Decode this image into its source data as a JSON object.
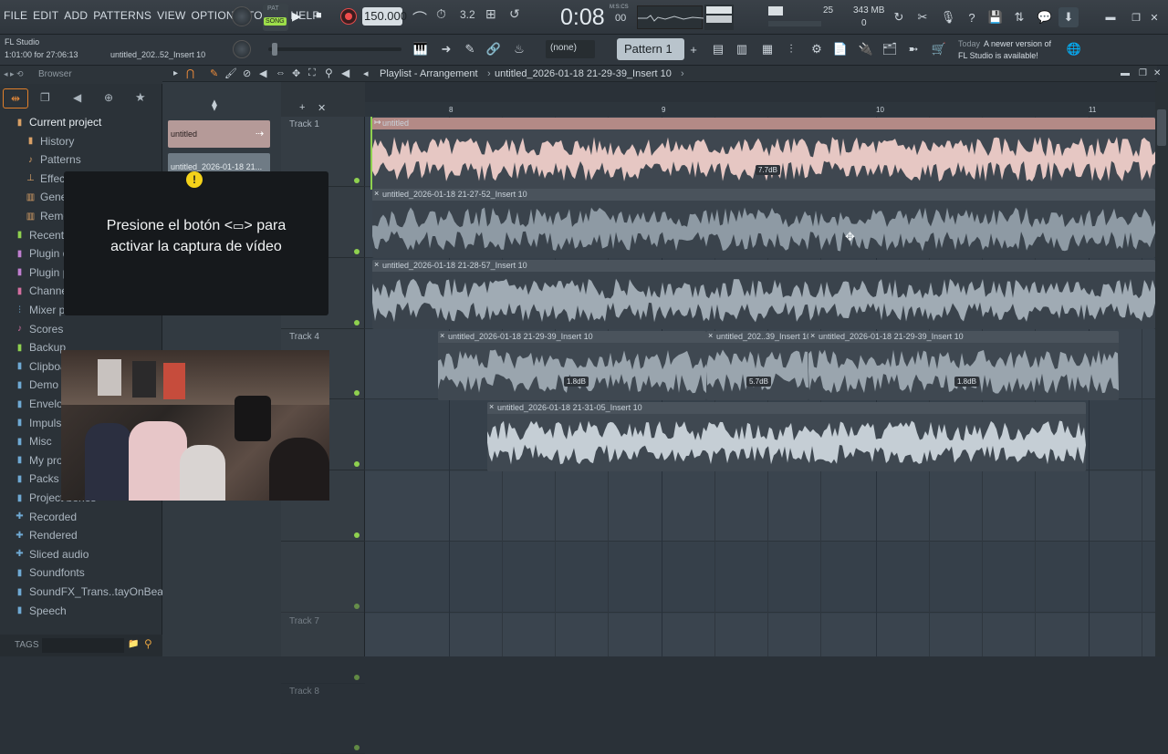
{
  "menu": [
    "FILE",
    "EDIT",
    "ADD",
    "PATTERNS",
    "VIEW",
    "OPTIONS",
    "TOOLS",
    "HELP"
  ],
  "transport": {
    "pat_label": "PAT",
    "song_label": "SONG",
    "tempo": "150.000",
    "time": "0:08",
    "time_small": "00",
    "time_unit": "M:S:CS"
  },
  "cpu": {
    "number": "25",
    "memory": "343 MB",
    "poly": "0"
  },
  "hint": {
    "app": "FL Studio",
    "status": "1:01:00 for 27:06:13",
    "file": "untitled_202..52_Insert 10"
  },
  "pattern": {
    "none": "(none)",
    "name": "Pattern 1"
  },
  "news": {
    "label": "Today",
    "text": "A newer version of",
    "text2": "FL Studio is available!"
  },
  "browser": {
    "title": "Browser",
    "items": [
      {
        "label": "Current project",
        "icon": "folder-icon",
        "color": "#d9a066"
      },
      {
        "label": "History",
        "icon": "history-icon",
        "color": "#d9a066"
      },
      {
        "label": "Patterns",
        "icon": "note-icon",
        "color": "#d9a066"
      },
      {
        "label": "Effects",
        "icon": "plug-icon",
        "color": "#d9a066"
      },
      {
        "label": "Generators",
        "icon": "gen-icon",
        "color": "#d9a066"
      },
      {
        "label": "Remote control",
        "icon": "remote-icon",
        "color": "#d9a066"
      },
      {
        "label": "Recent files",
        "icon": "recent-icon",
        "color": "#8fd14f"
      },
      {
        "label": "Plugin database",
        "icon": "plugin-icon",
        "color": "#c07fd0"
      },
      {
        "label": "Plugin presets",
        "icon": "plugin-icon",
        "color": "#c07fd0"
      },
      {
        "label": "Channel presets",
        "icon": "channel-icon",
        "color": "#d46fa0"
      },
      {
        "label": "Mixer presets",
        "icon": "mixer-icon",
        "color": "#6faad4"
      },
      {
        "label": "Scores",
        "icon": "score-icon",
        "color": "#d46fa0"
      },
      {
        "label": "Backup",
        "icon": "backup-icon",
        "color": "#8fd14f"
      },
      {
        "label": "Clipboard files",
        "icon": "folder-icon",
        "color": "#6faad4"
      },
      {
        "label": "Demo projects",
        "icon": "folder-icon",
        "color": "#6faad4"
      },
      {
        "label": "Envelopes",
        "icon": "folder-icon",
        "color": "#6faad4"
      },
      {
        "label": "Impulses",
        "icon": "folder-icon",
        "color": "#6faad4"
      },
      {
        "label": "Misc",
        "icon": "folder-icon",
        "color": "#6faad4"
      },
      {
        "label": "My projects",
        "icon": "folder-icon",
        "color": "#6faad4"
      },
      {
        "label": "Packs",
        "icon": "folder-icon",
        "color": "#6faad4"
      },
      {
        "label": "Project bones",
        "icon": "folder-icon",
        "color": "#6faad4"
      },
      {
        "label": "Recorded",
        "icon": "plus-icon",
        "color": "#6faad4"
      },
      {
        "label": "Rendered",
        "icon": "plus-icon",
        "color": "#6faad4"
      },
      {
        "label": "Sliced audio",
        "icon": "plus-icon",
        "color": "#6faad4"
      },
      {
        "label": "Soundfonts",
        "icon": "folder-icon",
        "color": "#6faad4"
      },
      {
        "label": "SoundFX_Trans..tayOnBeat_com",
        "icon": "folder-icon",
        "color": "#6faad4"
      },
      {
        "label": "Speech",
        "icon": "folder-icon",
        "color": "#6faad4"
      }
    ],
    "tags": "TAGS"
  },
  "playlist": {
    "title": "Playlist - Arrangement",
    "file": "untitled_2026-01-18 21-29-39_Insert 10",
    "ruler": [
      "8",
      "9",
      "10",
      "11"
    ],
    "tracks": [
      "Track 1",
      "",
      "",
      "Track 4",
      "",
      "",
      "",
      "Track 7",
      "Track 8"
    ]
  },
  "channels": [
    {
      "label": "untitled"
    },
    {
      "label": "untitled_2026-01-18 21..."
    }
  ],
  "clips": [
    {
      "title": "untitled",
      "db": "7.7dB"
    },
    {
      "title": "untitled_2026-01-18 21-27-52_Insert 10"
    },
    {
      "title": "untitled_2026-01-18 21-28-57_Insert 10"
    },
    {
      "title": "untitled_2026-01-18 21-29-39_Insert 10",
      "db": "1.8dB"
    },
    {
      "title": "untitled_202..39_Insert 10",
      "db": "5.7dB"
    },
    {
      "title": "untitled_2026-01-18 21-29-39_Insert 10",
      "db": "1.8dB"
    },
    {
      "title": "untitled_2026-01-18 21-31-05_Insert 10"
    }
  ],
  "overlay": {
    "text1": "Presione el botón <",
    "text_icon": "camera-icon",
    "text2": "> para",
    "text3": "activar la captura de vídeo"
  }
}
